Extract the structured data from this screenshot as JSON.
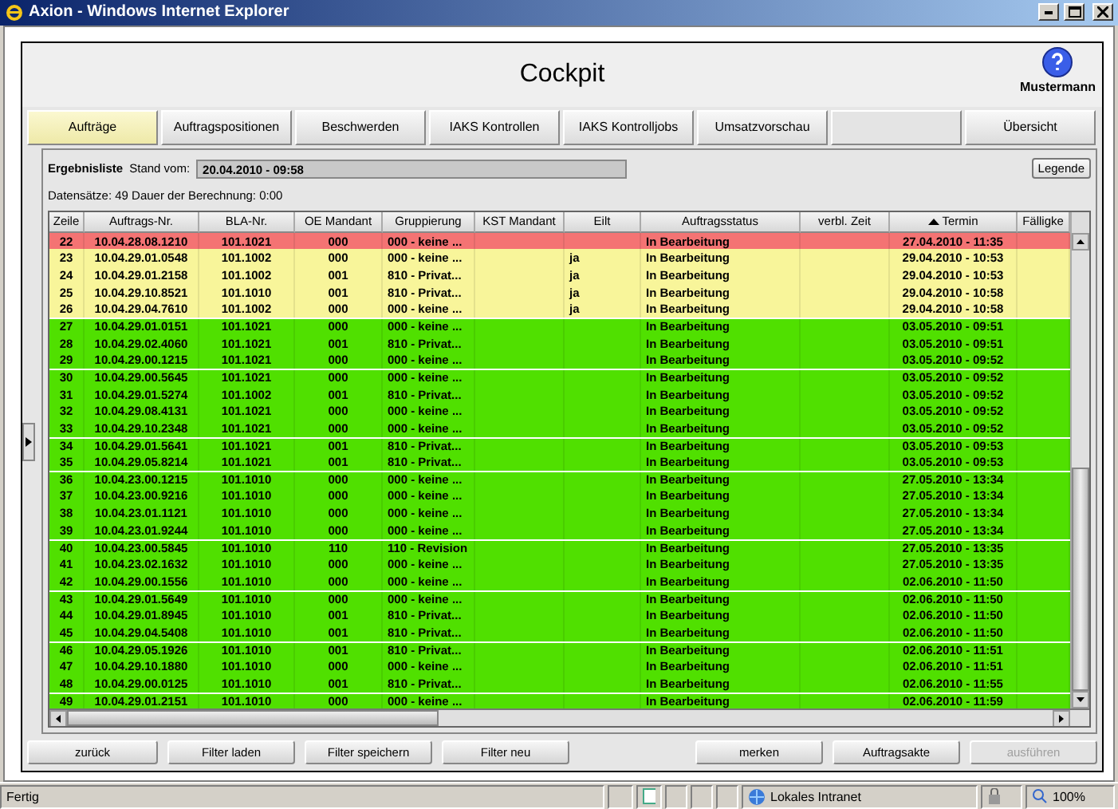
{
  "window": {
    "title": "Axion - Windows Internet Explorer"
  },
  "header": {
    "title": "Cockpit",
    "user": "Mustermann"
  },
  "tabs": [
    {
      "label": "Aufträge",
      "selected": true
    },
    {
      "label": "Auftragspositionen",
      "selected": false
    },
    {
      "label": "Beschwerden",
      "selected": false
    },
    {
      "label": "IAKS Kontrollen",
      "selected": false
    },
    {
      "label": "IAKS Kontrolljobs",
      "selected": false
    },
    {
      "label": "Umsatzvorschau",
      "selected": false
    },
    {
      "kind": "empty",
      "selected": false
    },
    {
      "label": "Übersicht",
      "selected": false
    }
  ],
  "result": {
    "title": "Ergebnisliste",
    "stand_label": "Stand vom:",
    "stand_value": "20.04.2010 - 09:58",
    "legend_button": "Legende",
    "summary": "Datensätze: 49  Dauer der Berechnung: 0:00"
  },
  "table": {
    "columns": [
      {
        "label": "Zeile",
        "sorted": false
      },
      {
        "label": "Auftrags-Nr.",
        "sorted": false
      },
      {
        "label": "BLA-Nr.",
        "sorted": false
      },
      {
        "label": "OE Mandant",
        "sorted": false
      },
      {
        "label": "Gruppierung",
        "sorted": false
      },
      {
        "label": "KST Mandant",
        "sorted": false
      },
      {
        "label": "Eilt",
        "sorted": false
      },
      {
        "label": "Auftragsstatus",
        "sorted": false
      },
      {
        "label": "verbl. Zeit",
        "sorted": false
      },
      {
        "label": "Termin",
        "sorted": true
      },
      {
        "label": "Fälligke",
        "sorted": false
      }
    ],
    "rows": [
      {
        "zeile": "22",
        "auftrags_nr": "10.04.28.08.1210",
        "bla_nr": "101.1021",
        "oe_mandant": "000",
        "gruppierung": "000 - keine ...",
        "status": "In Bearbeitung",
        "termin": "27.04.2010 - 11:35",
        "color": "#f47373"
      },
      {
        "zeile": "23",
        "auftrags_nr": "10.04.29.01.0548",
        "bla_nr": "101.1002",
        "oe_mandant": "000",
        "gruppierung": "000 - keine ...",
        "eilt": "ja",
        "status": "In Bearbeitung",
        "termin": "29.04.2010 - 10:53",
        "color": "#f8f59a"
      },
      {
        "zeile": "24",
        "auftrags_nr": "10.04.29.01.2158",
        "bla_nr": "101.1002",
        "oe_mandant": "001",
        "gruppierung": "810 - Privat...",
        "eilt": "ja",
        "status": "In Bearbeitung",
        "termin": "29.04.2010 - 10:53",
        "color": "#f8f59a"
      },
      {
        "zeile": "25",
        "auftrags_nr": "10.04.29.10.8521",
        "bla_nr": "101.1010",
        "oe_mandant": "001",
        "gruppierung": "810 - Privat...",
        "eilt": "ja",
        "status": "In Bearbeitung",
        "termin": "29.04.2010 - 10:58",
        "color": "#f8f59a"
      },
      {
        "zeile": "26",
        "auftrags_nr": "10.04.29.04.7610",
        "bla_nr": "101.1002",
        "oe_mandant": "000",
        "gruppierung": "000 - keine ...",
        "eilt": "ja",
        "status": "In Bearbeitung",
        "termin": "29.04.2010 - 10:58",
        "color": "#f8f59a"
      },
      {
        "zeile": "27",
        "auftrags_nr": "10.04.29.01.0151",
        "bla_nr": "101.1021",
        "oe_mandant": "000",
        "gruppierung": "000 - keine ...",
        "status": "In Bearbeitung",
        "termin": "03.05.2010 - 09:51",
        "color": "#50e000"
      },
      {
        "zeile": "28",
        "auftrags_nr": "10.04.29.02.4060",
        "bla_nr": "101.1021",
        "oe_mandant": "001",
        "gruppierung": "810 - Privat...",
        "status": "In Bearbeitung",
        "termin": "03.05.2010 - 09:51",
        "color": "#50e000"
      },
      {
        "zeile": "29",
        "auftrags_nr": "10.04.29.00.1215",
        "bla_nr": "101.1021",
        "oe_mandant": "000",
        "gruppierung": "000 - keine ...",
        "status": "In Bearbeitung",
        "termin": "03.05.2010 - 09:52",
        "color": "#50e000"
      },
      {
        "zeile": "30",
        "auftrags_nr": "10.04.29.00.5645",
        "bla_nr": "101.1021",
        "oe_mandant": "000",
        "gruppierung": "000 - keine ...",
        "status": "In Bearbeitung",
        "termin": "03.05.2010 - 09:52",
        "color": "#50e000"
      },
      {
        "zeile": "31",
        "auftrags_nr": "10.04.29.01.5274",
        "bla_nr": "101.1002",
        "oe_mandant": "001",
        "gruppierung": "810 - Privat...",
        "status": "In Bearbeitung",
        "termin": "03.05.2010 - 09:52",
        "color": "#50e000"
      },
      {
        "zeile": "32",
        "auftrags_nr": "10.04.29.08.4131",
        "bla_nr": "101.1021",
        "oe_mandant": "000",
        "gruppierung": "000 - keine ...",
        "status": "In Bearbeitung",
        "termin": "03.05.2010 - 09:52",
        "color": "#50e000"
      },
      {
        "zeile": "33",
        "auftrags_nr": "10.04.29.10.2348",
        "bla_nr": "101.1021",
        "oe_mandant": "000",
        "gruppierung": "000 - keine ...",
        "status": "In Bearbeitung",
        "termin": "03.05.2010 - 09:52",
        "color": "#50e000"
      },
      {
        "zeile": "34",
        "auftrags_nr": "10.04.29.01.5641",
        "bla_nr": "101.1021",
        "oe_mandant": "001",
        "gruppierung": "810 - Privat...",
        "status": "In Bearbeitung",
        "termin": "03.05.2010 - 09:53",
        "color": "#50e000"
      },
      {
        "zeile": "35",
        "auftrags_nr": "10.04.29.05.8214",
        "bla_nr": "101.1021",
        "oe_mandant": "001",
        "gruppierung": "810 - Privat...",
        "status": "In Bearbeitung",
        "termin": "03.05.2010 - 09:53",
        "color": "#50e000"
      },
      {
        "zeile": "36",
        "auftrags_nr": "10.04.23.00.1215",
        "bla_nr": "101.1010",
        "oe_mandant": "000",
        "gruppierung": "000 - keine ...",
        "status": "In Bearbeitung",
        "termin": "27.05.2010 - 13:34",
        "color": "#50e000"
      },
      {
        "zeile": "37",
        "auftrags_nr": "10.04.23.00.9216",
        "bla_nr": "101.1010",
        "oe_mandant": "000",
        "gruppierung": "000 - keine ...",
        "status": "In Bearbeitung",
        "termin": "27.05.2010 - 13:34",
        "color": "#50e000"
      },
      {
        "zeile": "38",
        "auftrags_nr": "10.04.23.01.1121",
        "bla_nr": "101.1010",
        "oe_mandant": "000",
        "gruppierung": "000 - keine ...",
        "status": "In Bearbeitung",
        "termin": "27.05.2010 - 13:34",
        "color": "#50e000"
      },
      {
        "zeile": "39",
        "auftrags_nr": "10.04.23.01.9244",
        "bla_nr": "101.1010",
        "oe_mandant": "000",
        "gruppierung": "000 - keine ...",
        "status": "In Bearbeitung",
        "termin": "27.05.2010 - 13:34",
        "color": "#50e000"
      },
      {
        "zeile": "40",
        "auftrags_nr": "10.04.23.00.5845",
        "bla_nr": "101.1010",
        "oe_mandant": "110",
        "gruppierung": "110 - Revision",
        "status": "In Bearbeitung",
        "termin": "27.05.2010 - 13:35",
        "color": "#50e000"
      },
      {
        "zeile": "41",
        "auftrags_nr": "10.04.23.02.1632",
        "bla_nr": "101.1010",
        "oe_mandant": "000",
        "gruppierung": "000 - keine ...",
        "status": "In Bearbeitung",
        "termin": "27.05.2010 - 13:35",
        "color": "#50e000"
      },
      {
        "zeile": "42",
        "auftrags_nr": "10.04.29.00.1556",
        "bla_nr": "101.1010",
        "oe_mandant": "000",
        "gruppierung": "000 - keine ...",
        "status": "In Bearbeitung",
        "termin": "02.06.2010 - 11:50",
        "color": "#50e000"
      },
      {
        "zeile": "43",
        "auftrags_nr": "10.04.29.01.5649",
        "bla_nr": "101.1010",
        "oe_mandant": "000",
        "gruppierung": "000 - keine ...",
        "status": "In Bearbeitung",
        "termin": "02.06.2010 - 11:50",
        "color": "#50e000"
      },
      {
        "zeile": "44",
        "auftrags_nr": "10.04.29.01.8945",
        "bla_nr": "101.1010",
        "oe_mandant": "001",
        "gruppierung": "810 - Privat...",
        "status": "In Bearbeitung",
        "termin": "02.06.2010 - 11:50",
        "color": "#50e000"
      },
      {
        "zeile": "45",
        "auftrags_nr": "10.04.29.04.5408",
        "bla_nr": "101.1010",
        "oe_mandant": "001",
        "gruppierung": "810 - Privat...",
        "status": "In Bearbeitung",
        "termin": "02.06.2010 - 11:50",
        "color": "#50e000"
      },
      {
        "zeile": "46",
        "auftrags_nr": "10.04.29.05.1926",
        "bla_nr": "101.1010",
        "oe_mandant": "001",
        "gruppierung": "810 - Privat...",
        "status": "In Bearbeitung",
        "termin": "02.06.2010 - 11:51",
        "color": "#50e000"
      },
      {
        "zeile": "47",
        "auftrags_nr": "10.04.29.10.1880",
        "bla_nr": "101.1010",
        "oe_mandant": "000",
        "gruppierung": "000 - keine ...",
        "status": "In Bearbeitung",
        "termin": "02.06.2010 - 11:51",
        "color": "#50e000"
      },
      {
        "zeile": "48",
        "auftrags_nr": "10.04.29.00.0125",
        "bla_nr": "101.1010",
        "oe_mandant": "001",
        "gruppierung": "810 - Privat...",
        "status": "In Bearbeitung",
        "termin": "02.06.2010 - 11:55",
        "color": "#50e000"
      },
      {
        "zeile": "49",
        "auftrags_nr": "10.04.29.01.2151",
        "bla_nr": "101.1010",
        "oe_mandant": "000",
        "gruppierung": "000 - keine ...",
        "status": "In Bearbeitung",
        "termin": "02.06.2010 - 11:59",
        "color": "#50e000"
      }
    ]
  },
  "left_buttons": [
    {
      "label": "zurück",
      "disabled": false
    },
    {
      "label": "Filter laden",
      "disabled": false
    },
    {
      "label": "Filter speichern",
      "disabled": false
    },
    {
      "label": "Filter neu",
      "disabled": false
    }
  ],
  "right_buttons": [
    {
      "label": "merken",
      "disabled": false
    },
    {
      "label": "Auftragsakte",
      "disabled": false
    },
    {
      "label": "ausführen",
      "disabled": true
    }
  ],
  "status_bar": {
    "status": "Fertig",
    "zone": "Lokales Intranet",
    "zoom": "100%"
  }
}
